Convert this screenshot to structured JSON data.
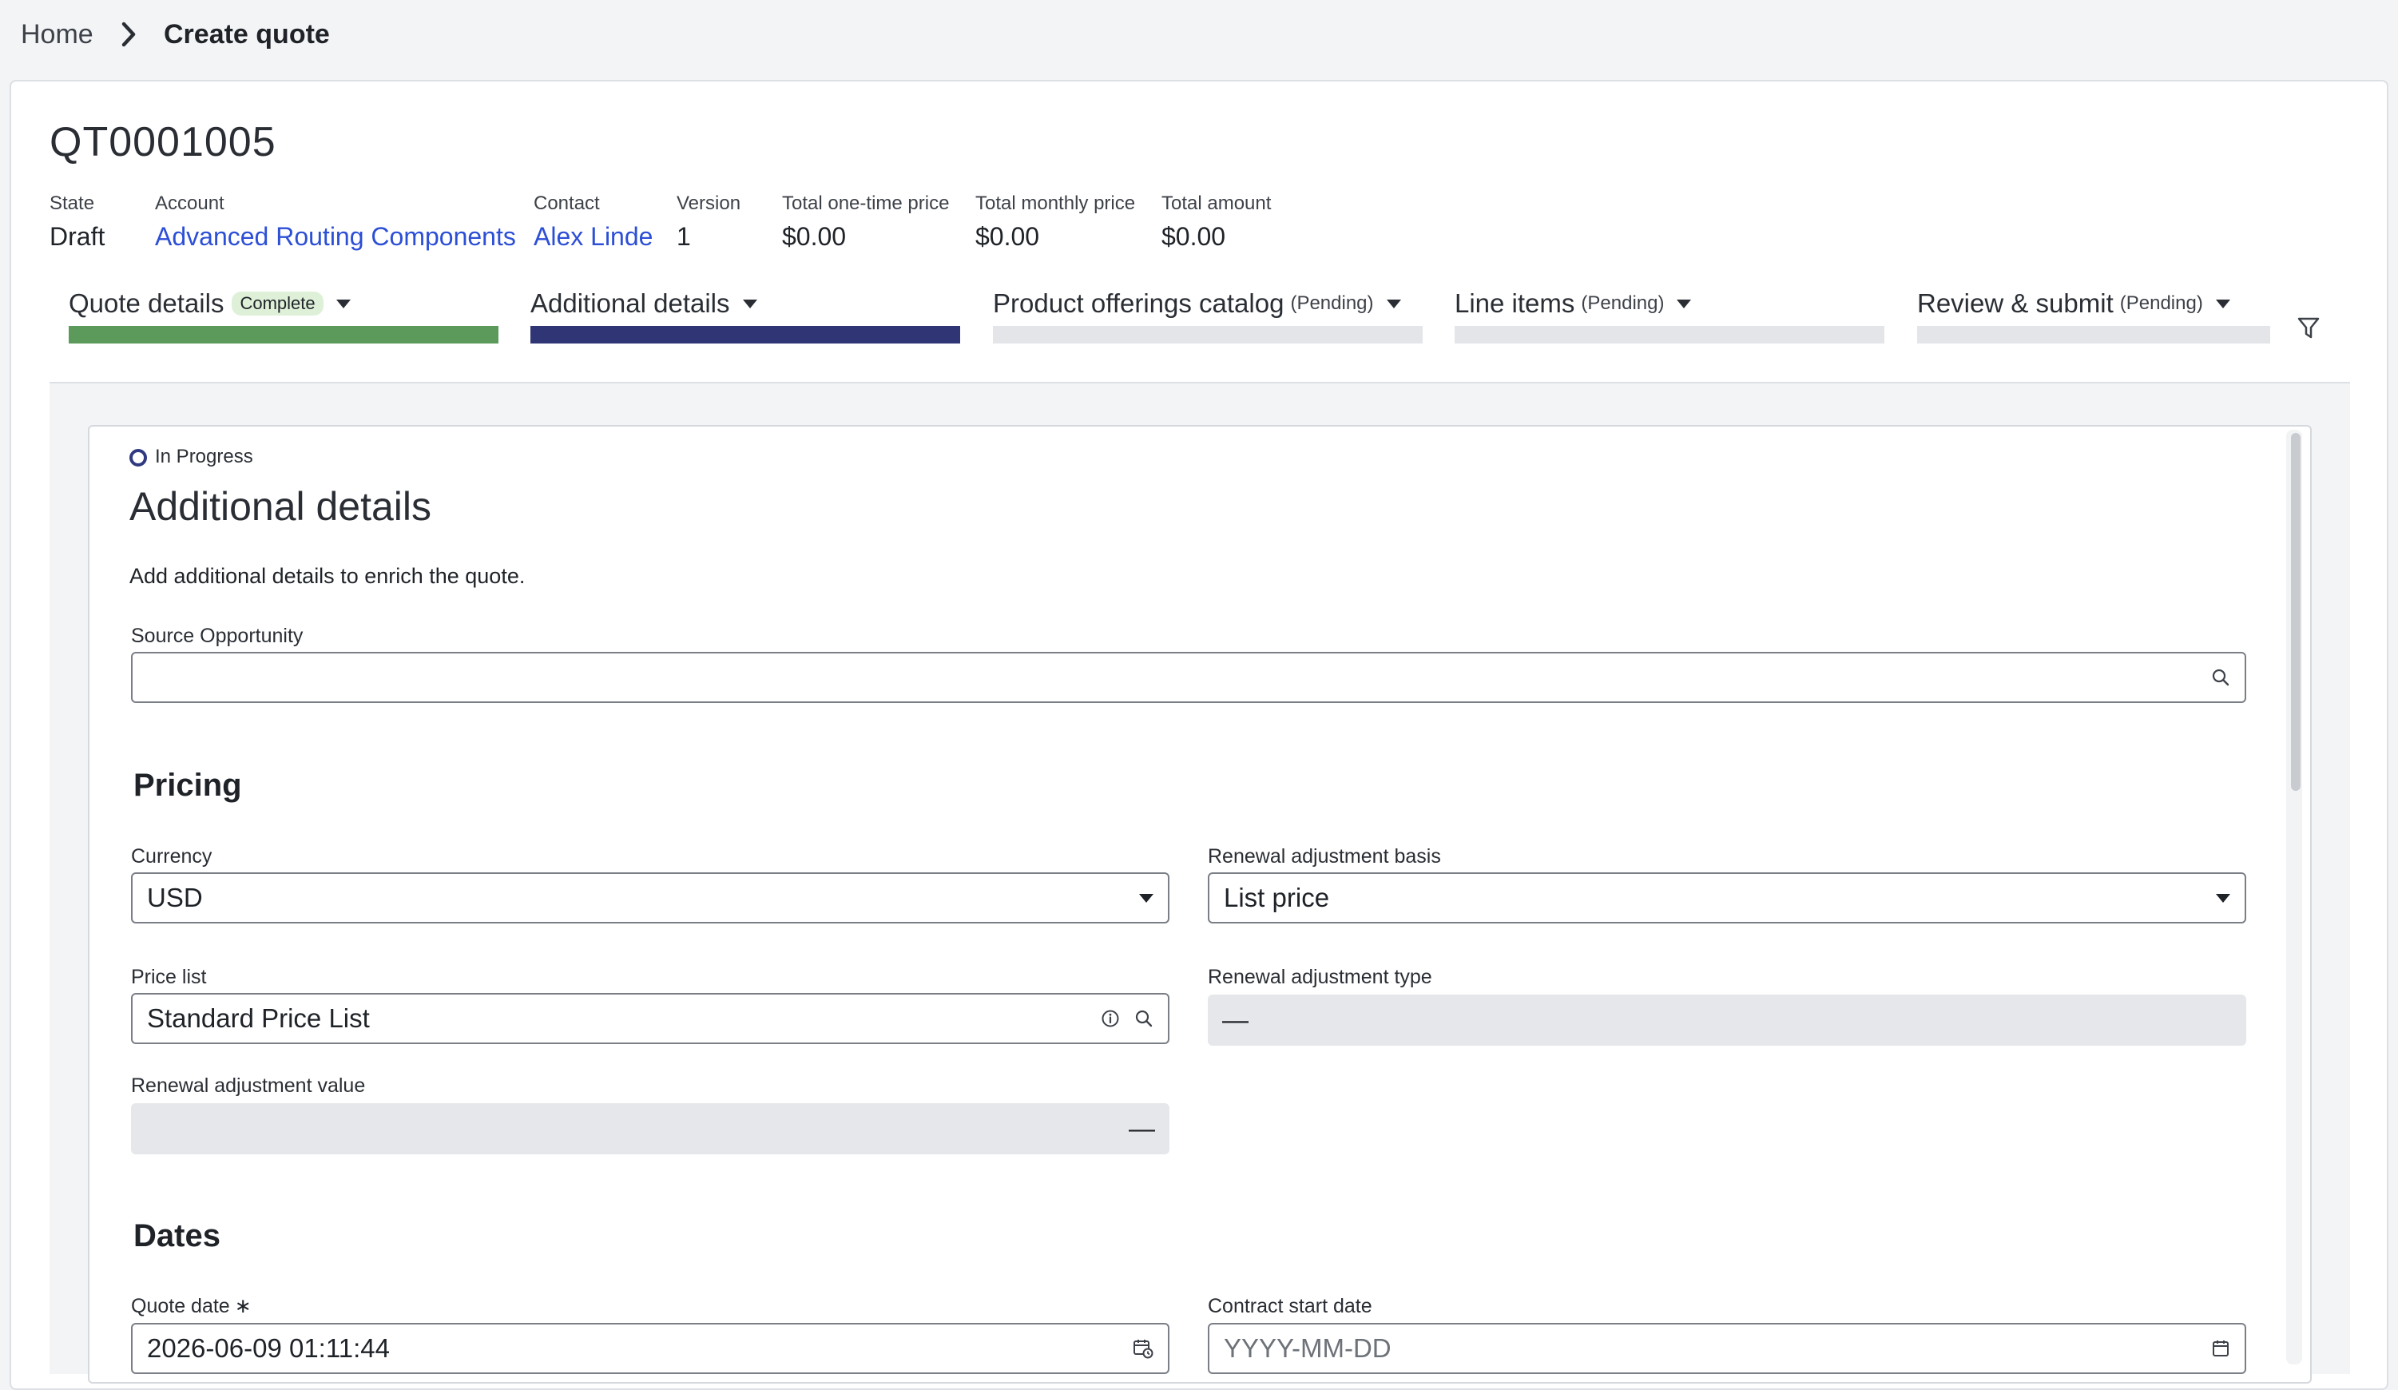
{
  "breadcrumb": {
    "home": "Home",
    "current": "Create quote"
  },
  "quote": {
    "id": "QT0001005",
    "meta": [
      {
        "label": "State",
        "value": "Draft",
        "link": false
      },
      {
        "label": "Account",
        "value": "Advanced Routing Components",
        "link": true
      },
      {
        "label": "Contact",
        "value": "Alex Linde",
        "link": true
      },
      {
        "label": "Version",
        "value": "1",
        "link": false
      },
      {
        "label": "Total one-time price",
        "value": "$0.00",
        "link": false
      },
      {
        "label": "Total monthly price",
        "value": "$0.00",
        "link": false
      },
      {
        "label": "Total amount",
        "value": "$0.00",
        "link": false
      }
    ]
  },
  "steps": [
    {
      "label": "Quote details",
      "badge": "Complete",
      "status": "complete",
      "progress_pct": 100
    },
    {
      "label": "Additional details",
      "badge": "",
      "status": "current",
      "progress_pct": 100
    },
    {
      "label": "Product offerings catalog",
      "badge": "(Pending)",
      "status": "pending",
      "progress_pct": 0
    },
    {
      "label": "Line items",
      "badge": "(Pending)",
      "status": "pending",
      "progress_pct": 0
    },
    {
      "label": "Review & submit",
      "badge": "(Pending)",
      "status": "pending",
      "progress_pct": 0
    }
  ],
  "colors": {
    "complete": "#5b9a5b",
    "current": "#2f3575",
    "pending": "#e4e5e8",
    "link": "#2c4fd6"
  },
  "panel": {
    "status": "In Progress",
    "title": "Additional details",
    "description": "Add additional details to enrich the quote.",
    "source_opportunity": {
      "label": "Source Opportunity",
      "value": ""
    },
    "pricing": {
      "title": "Pricing",
      "currency": {
        "label": "Currency",
        "value": "USD"
      },
      "renewal_adjustment_basis": {
        "label": "Renewal adjustment basis",
        "value": "List price"
      },
      "price_list": {
        "label": "Price list",
        "value": "Standard Price List"
      },
      "renewal_adjustment_type": {
        "label": "Renewal adjustment type",
        "value": "—"
      },
      "renewal_adjustment_value": {
        "label": "Renewal adjustment value",
        "value": "—"
      }
    },
    "dates": {
      "title": "Dates",
      "quote_date": {
        "label": "Quote date",
        "required_mark": "∗",
        "value": "2026-06-09 01:11:44"
      },
      "contract_start_date": {
        "label": "Contract start date",
        "placeholder": "YYYY-MM-DD"
      }
    }
  }
}
